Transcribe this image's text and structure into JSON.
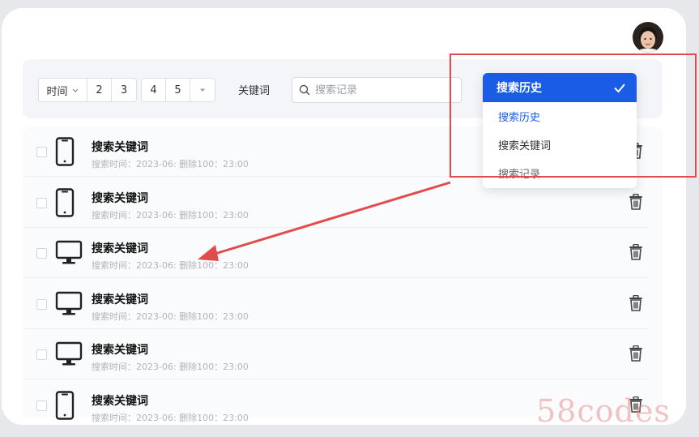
{
  "filter": {
    "time_label": "时间",
    "pages": [
      "2",
      "3",
      "4",
      "5"
    ],
    "keyword_label": "关键词"
  },
  "search": {
    "placeholder": "搜索记录"
  },
  "rows": [
    {
      "device": "phone-icon",
      "title": "搜索关键词",
      "meta": "搜索时间：2023-06: 删除100：23:00"
    },
    {
      "device": "phone-icon",
      "title": "搜索关键词",
      "meta": "搜索时间：2023-06: 删除100：23:00"
    },
    {
      "device": "monitor-icon",
      "title": "搜索关键词",
      "meta": "搜索时间：2023-06: 删除100：23:00"
    },
    {
      "device": "monitor-icon",
      "title": "搜索关键词",
      "meta": "搜索时间：2023-00: 删除100：23:00"
    },
    {
      "device": "monitor-icon",
      "title": "搜索关键词",
      "meta": "搜索时间：2023-06: 删除100：23:00"
    },
    {
      "device": "phone-icon",
      "title": "搜索关键词",
      "meta": "搜索时间：2023-06: 删除100：23:00"
    }
  ],
  "dropdown": {
    "selected": "搜索历史",
    "items": [
      "搜索历史",
      "搜索关键词",
      "搜索记录"
    ]
  },
  "watermark": "58codes",
  "colors": {
    "accent": "#1a5ce6",
    "highlight": "#e24b4b"
  }
}
